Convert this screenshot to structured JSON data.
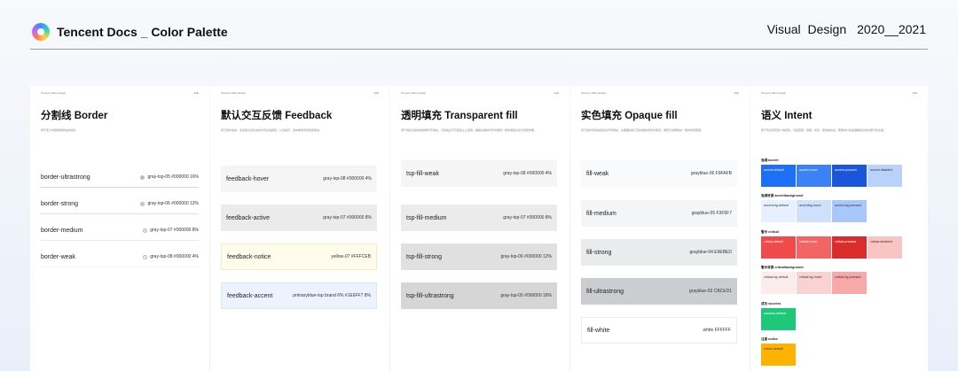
{
  "header": {
    "title": "Tencent Docs _ Color Palette",
    "right_label": "Visual Design",
    "years": "2020__2021"
  },
  "panels": [
    {
      "head_left": "Tencent office design",
      "head_right": "Edit",
      "title": "分割线 Border",
      "desc": "用于区分内容或者模块的线条。",
      "rows": [
        {
          "name": "border-ultrastrong",
          "meta": "gray-tsp-05  #000000  16%"
        },
        {
          "name": "border-strong",
          "meta": "gray-tsp-06  #000000  12%"
        },
        {
          "name": "border-medium",
          "meta": "gray-tsp-07  #000000  8%"
        },
        {
          "name": "border-weak",
          "meta": "gray-tsp-08  #000000  4%"
        }
      ]
    },
    {
      "head_left": "Tencent office design",
      "head_right": "Edit",
      "title": "默认交互反馈 Feedback",
      "desc": "用于鼠标悬停、点击等交互状态的背景反馈颜色，以及提示、选中等场景的底色填充。",
      "rows": [
        {
          "name": "feedback-hover",
          "meta": "gray-tsp-08  #000000  4%"
        },
        {
          "name": "feedback-active",
          "meta": "gray-tsp-07  #000000  8%"
        },
        {
          "name": "feedback-notice",
          "meta": "yellow-07  #FFFCEB"
        },
        {
          "name": "feedback-accent",
          "meta": "primaryblue-tsp brand 6%  #1E6FF7 8%"
        }
      ]
    },
    {
      "head_left": "Tencent office design",
      "head_right": "Edit",
      "title": "透明填充 Transparent fill",
      "desc": "用于组件及模块的透明背景填充，可叠加在不同底色之上使用，确保在各种背景中保持一致的层级关系与视觉效果。",
      "rows": [
        {
          "name": "tsp-fill-weak",
          "meta": "gray-tsp-08  #000000  4%"
        },
        {
          "name": "tsp-fill-medium",
          "meta": "gray-tsp-07  #000000  8%"
        },
        {
          "name": "tsp-fill-strong",
          "meta": "gray-tsp-06  #000000  12%"
        },
        {
          "name": "tsp-fill-ultrastrong",
          "meta": "gray-tsp-05  #000000  16%"
        }
      ]
    },
    {
      "head_left": "Tencent office design",
      "head_right": "Edit",
      "title": "实色填充 Opaque fill",
      "desc": "用于组件及模块的实色背景填充，在需要遮挡下层内容的场景中使用，保持与透明填充一致的视觉层级。",
      "rows": [
        {
          "name": "fill-weak",
          "meta": "grayblue-06  F9FAFB"
        },
        {
          "name": "fill-medium",
          "meta": "grayblue-05  F3F5F7"
        },
        {
          "name": "fill-strong",
          "meta": "grayblue-04  E9EBED"
        },
        {
          "name": "fill-ultrastrong",
          "meta": "grayblue-03  CBCED1"
        },
        {
          "name": "fill-white",
          "meta": "white  FFFFFF"
        }
      ]
    },
    {
      "head_left": "Tencent office design",
      "head_right": "Edit",
      "title": "语义 Intent",
      "desc": "用于传达特定含义的颜色，包括强调、错误、成功、警告等状态，帮助用户快速理解信息的性质与优先级。",
      "groups": [
        {
          "label": "强调 accent",
          "chips": [
            "accent-default",
            "accent-hover",
            "accent-pressed",
            "accent-disabled"
          ]
        },
        {
          "label": "强调背景 accentbackground",
          "chips": [
            "accent-bg-default",
            "accentbg-hover",
            "accent-bg-pressed"
          ]
        },
        {
          "label": "警示 critical",
          "chips": [
            "critical-default",
            "critical-hover",
            "critical-pressed",
            "critical-disabled"
          ]
        },
        {
          "label": "警示背景 criticalbackground",
          "chips": [
            "critical-bg-default",
            "critical-bg-hover",
            "critical-bg-pressed"
          ]
        },
        {
          "label": "成功 success",
          "chips": [
            "success-default"
          ]
        },
        {
          "label": "注意 notice",
          "chips": [
            "notice-default"
          ]
        }
      ]
    }
  ],
  "colors": {
    "accent": [
      "#1e6ff7",
      "#3b82f6",
      "#1a56db",
      "#b8d2fb"
    ],
    "accent_bg": [
      "#e6f0fe",
      "#cfe0fd",
      "#a8c7fb"
    ],
    "critical": [
      "#f04a4a",
      "#f36464",
      "#d92d2d",
      "#fbc4c4"
    ],
    "critical_bg": [
      "#fdecec",
      "#fbd2d2",
      "#f8a8a8"
    ],
    "success": [
      "#1fc77a"
    ],
    "notice": [
      "#ffb300"
    ]
  }
}
